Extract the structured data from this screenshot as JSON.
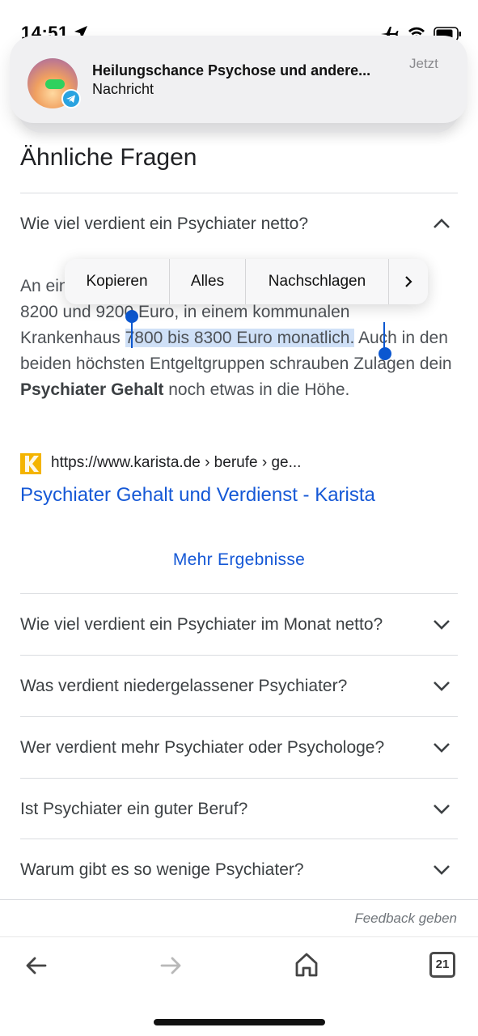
{
  "status_bar": {
    "time": "14:51",
    "icons": [
      "location-arrow-icon",
      "airplane-icon",
      "wifi-icon",
      "battery-icon"
    ]
  },
  "notification": {
    "title": "Heilungschance Psychose und andere...",
    "subtitle": "Nachricht",
    "time": "Jetzt",
    "app_icon": "telegram-icon"
  },
  "section": {
    "title": "Ähnliche Fragen"
  },
  "expanded_question": {
    "text": "Wie viel verdient ein Psychiater netto?",
    "answer": {
      "part1_prefix": "An ein",
      "part1_suffix": "n Krankenhaus",
      "line2": "8200 und 9200 Euro, in einem kommunalen",
      "line3_start": "Krankenhaus ",
      "selected": "7800 bis 8300 Euro monatlich.",
      "after_selected": " Auch in den beiden höchsten Entgeltgruppen schrauben Zulagen dein ",
      "bold": "Psychiater Gehalt",
      "end": " noch etwas in die Höhe."
    }
  },
  "context_menu": {
    "copy": "Kopieren",
    "all": "Alles",
    "lookup": "Nachschlagen",
    "more": "›"
  },
  "source": {
    "url": "https://www.karista.de › berufe › ge...",
    "link_title": "Psychiater Gehalt und Verdienst - Karista"
  },
  "more_results": "Mehr Ergebnisse",
  "questions": [
    "Wie viel verdient ein Psychiater im Monat netto?",
    "Was verdient niedergelassener Psychiater?",
    "Wer verdient mehr Psychiater oder Psychologe?",
    "Ist Psychiater ein guter Beruf?",
    "Warum gibt es so wenige Psychiater?"
  ],
  "feedback": "Feedback geben",
  "toolbar": {
    "tab_count": "21"
  },
  "colors": {
    "link": "#1558d6",
    "selection": "#cfe0f7",
    "handle": "#0b57d0"
  }
}
